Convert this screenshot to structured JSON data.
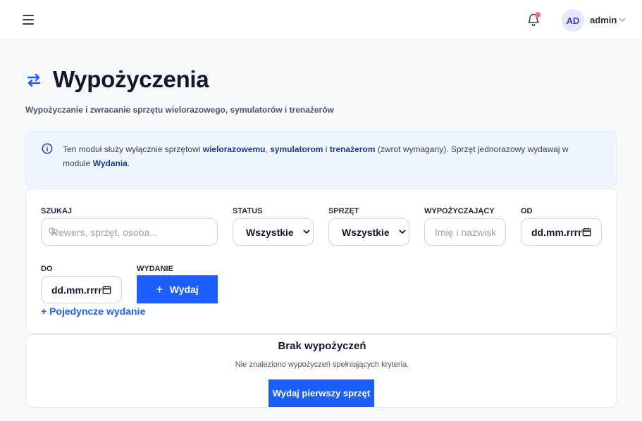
{
  "header": {
    "avatar_initials": "AD",
    "username": "admin",
    "notification_dot_color": "#f87171"
  },
  "page": {
    "title": "Wypożyczenia",
    "subtitle": "Wypożyczanie i zwracanie sprzętu wielorazowego, symulatorów i trenażerów",
    "accent_color": "#1d5eff"
  },
  "info": {
    "t1": "Ten moduł służy wyłącznie sprzętowi ",
    "b1": "wielorazowemu",
    "t2": ", ",
    "b2": "symulatorom",
    "t3": " i ",
    "b3": "trenażerom",
    "t4": " (zwrot wymagany). Sprzęt jednorazowy wydawaj w module ",
    "b4": "Wydania",
    "t5": "."
  },
  "filters": {
    "search": {
      "label": "SZUKAJ",
      "placeholder": "Rewers, sprzęt, osoba...",
      "value": ""
    },
    "status": {
      "label": "STATUS",
      "selected": "Wszystkie"
    },
    "equipment": {
      "label": "SPRZĘT",
      "selected": "Wszystkie"
    },
    "borrower": {
      "label": "WYPOŻYCZAJĄCY",
      "placeholder": "Imię i nazwisko",
      "value": ""
    },
    "date_from": {
      "label": "OD",
      "value": "dd.mm.rrrr"
    },
    "date_to": {
      "label": "DO",
      "value": "dd.mm.rrrr"
    },
    "issue": {
      "label": "WYDANIE",
      "button_label": "Wydaj",
      "button_prefix": "+"
    },
    "single_issue_link": "+ Pojedyncze wydanie"
  },
  "empty_state": {
    "title": "Brak wypożyczeń",
    "text": "Nie znaleziono wypożyczeń spełniających kryteria.",
    "button_label": "Wydaj pierwszy sprzęt"
  },
  "icons": {
    "menu": "hamburger-icon",
    "notifications": "bell-icon",
    "user_menu": "chevron-down-icon",
    "title": "swap-arrows-icon",
    "info": "info-circle-icon",
    "search": "search-icon",
    "calendar": "calendar-icon"
  }
}
